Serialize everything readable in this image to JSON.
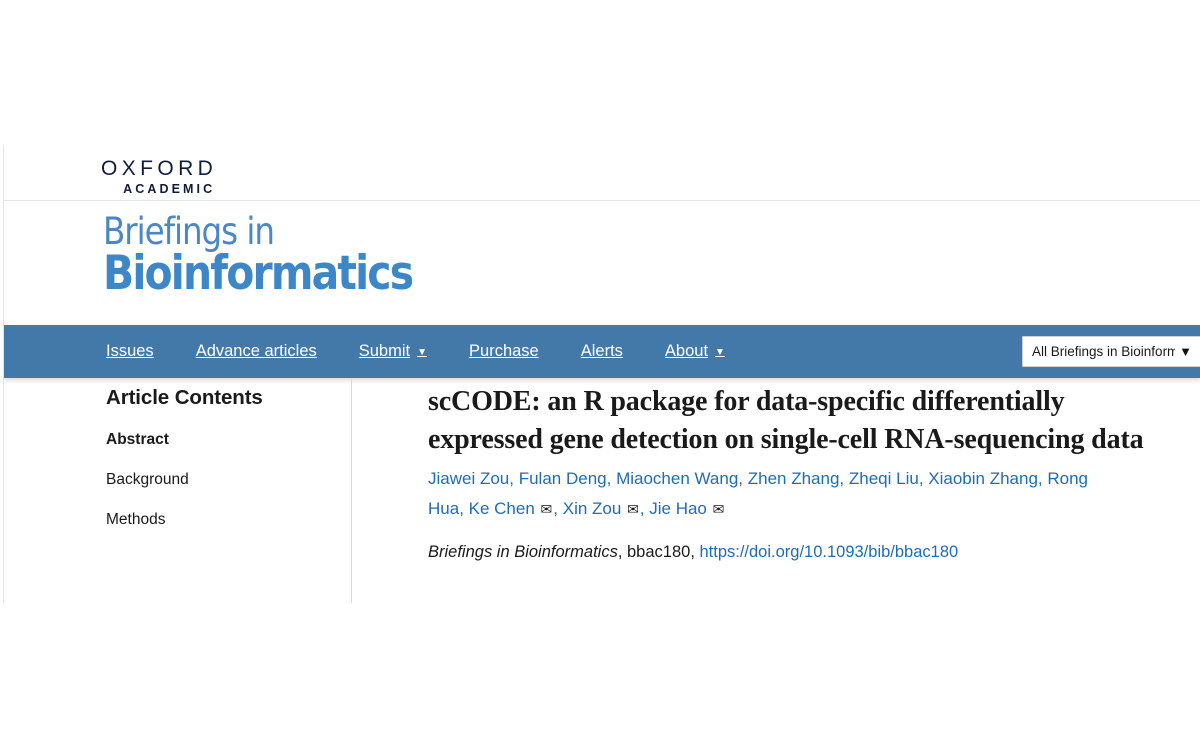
{
  "publisher": {
    "logo_line1": "OXFORD",
    "logo_line2": "ACADEMIC"
  },
  "journal": {
    "logo_line1": "Briefings in",
    "logo_line2": "Bioinformatics"
  },
  "nav": {
    "background_color": "#4279a9",
    "items": [
      {
        "label": "Issues",
        "has_caret": false
      },
      {
        "label": "Advance articles",
        "has_caret": false
      },
      {
        "label": "Submit",
        "has_caret": true
      },
      {
        "label": "Purchase",
        "has_caret": false
      },
      {
        "label": "Alerts",
        "has_caret": false
      },
      {
        "label": "About",
        "has_caret": true
      }
    ],
    "caret_glyph": "▼",
    "journal_select": {
      "value": "All Briefings in Bioinform",
      "caret_glyph": "▼"
    }
  },
  "sidebar": {
    "title": "Article Contents",
    "items": [
      {
        "label": "Abstract",
        "active": true
      },
      {
        "label": "Background",
        "active": false
      },
      {
        "label": "Methods",
        "active": false
      }
    ]
  },
  "article": {
    "title": "scCODE: an R package for data-specific differentially expressed gene detection on single-cell RNA-sequencing data",
    "authors": [
      {
        "name": "Jiawei Zou",
        "corresponding": false
      },
      {
        "name": "Fulan Deng",
        "corresponding": false
      },
      {
        "name": "Miaochen Wang",
        "corresponding": false
      },
      {
        "name": "Zhen Zhang",
        "corresponding": false
      },
      {
        "name": "Zheqi Liu",
        "corresponding": false
      },
      {
        "name": "Xiaobin Zhang",
        "corresponding": false
      },
      {
        "name": "Rong Hua",
        "corresponding": false
      },
      {
        "name": "Ke Chen",
        "corresponding": true
      },
      {
        "name": "Xin Zou",
        "corresponding": true
      },
      {
        "name": "Jie Hao",
        "corresponding": true
      }
    ],
    "mail_glyph": "✉",
    "citation": {
      "journal": "Briefings in Bioinformatics",
      "article_id": "bbac180",
      "doi_url": "https://doi.org/10.1093/bib/bbac180"
    }
  },
  "colors": {
    "nav_blue": "#4279a9",
    "link_blue": "#1f6cb5",
    "journal_blue": "#3d87c9",
    "journal_light_blue": "#4a87c4",
    "oxford_navy": "#111c3d"
  }
}
